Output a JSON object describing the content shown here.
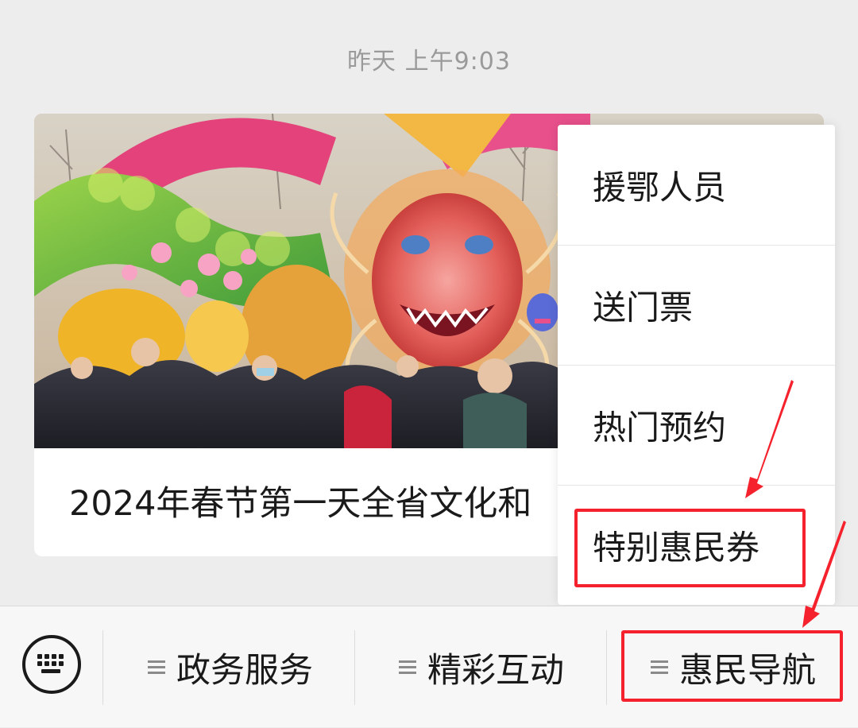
{
  "chat": {
    "timestamp": "昨天 上午9:03"
  },
  "article": {
    "title": "2024年春节第一天全省文化和"
  },
  "menu": {
    "items": [
      {
        "label": "援鄂人员"
      },
      {
        "label": "送门票"
      },
      {
        "label": "热门预约"
      },
      {
        "label": "特别惠民券"
      }
    ]
  },
  "bottom_bar": {
    "keyboard_icon": "keyboard-icon",
    "tabs": [
      {
        "label": "政务服务",
        "icon": "menu-lines-icon"
      },
      {
        "label": "精彩互动",
        "icon": "menu-lines-icon"
      },
      {
        "label": "惠民导航",
        "icon": "menu-lines-icon"
      }
    ]
  },
  "colors": {
    "highlight": "#f5222d",
    "background": "#ededed",
    "card": "#ffffff"
  }
}
